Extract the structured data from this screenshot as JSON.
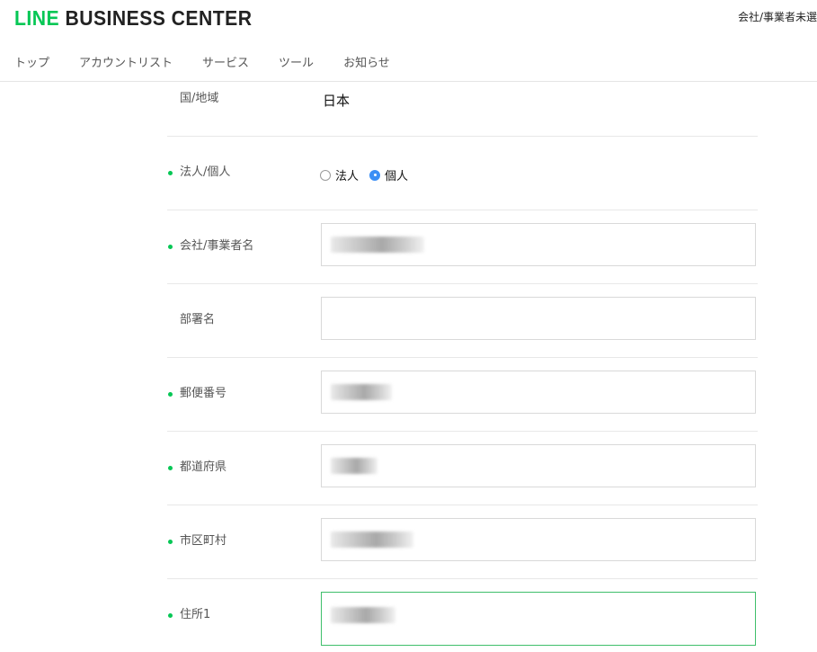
{
  "header": {
    "logo_line": "LINE",
    "logo_business": "BUSINESS CENTER",
    "company_status": "会社/事業者未選"
  },
  "nav": {
    "items": [
      "トップ",
      "アカウントリスト",
      "サービス",
      "ツール",
      "お知らせ"
    ]
  },
  "form": {
    "country_label": "国/地域",
    "country_value": "日本",
    "entity_label": "法人/個人",
    "entity_options": [
      "法人",
      "個人"
    ],
    "entity_selected": "個人",
    "company_label": "会社/事業者名",
    "department_label": "部署名",
    "postal_label": "郵便番号",
    "prefecture_label": "都道府県",
    "city_label": "市区町村",
    "address1_label": "住所1"
  },
  "colors": {
    "brand_green": "#06c755",
    "radio_blue": "#3b8ff5",
    "focus_border": "#3fbf6b"
  }
}
